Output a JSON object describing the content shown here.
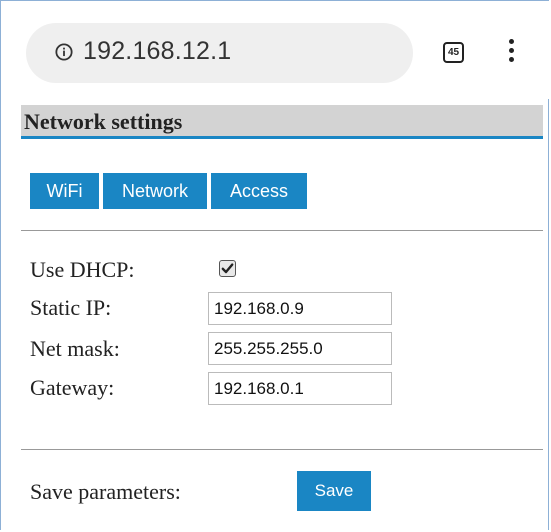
{
  "browser": {
    "url": "192.168.12.1",
    "tab_count": "45",
    "icons": [
      "info-icon",
      "tabs-icon",
      "more-vert-icon"
    ]
  },
  "page": {
    "title": "Network settings"
  },
  "tabs": [
    {
      "label": "WiFi"
    },
    {
      "label": "Network"
    },
    {
      "label": "Access"
    }
  ],
  "form": {
    "use_dhcp": {
      "label": "Use DHCP:",
      "checked": true
    },
    "static_ip": {
      "label": "Static IP:",
      "value": "192.168.0.9"
    },
    "net_mask": {
      "label": "Net mask:",
      "value": "255.255.255.0"
    },
    "gateway": {
      "label": "Gateway:",
      "value": "192.168.0.1"
    }
  },
  "save": {
    "label": "Save parameters:",
    "button": "Save"
  },
  "colors": {
    "accent": "#1a86c4",
    "header_bg": "#d3d3d3",
    "urlbar_bg": "#efefef"
  }
}
